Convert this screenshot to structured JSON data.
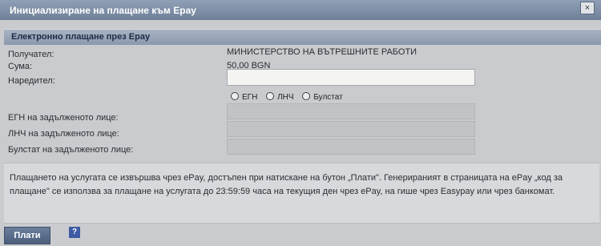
{
  "window": {
    "title": "Инициализиране на плащане към Epay",
    "close_glyph": "×"
  },
  "section": {
    "title": "Електронно плащане през Epay"
  },
  "form": {
    "recipient_label": "Получател:",
    "recipient_value": "МИНИСТЕРСТВО НА ВЪТРЕШНИТЕ РАБОТИ",
    "amount_label": "Сума:",
    "amount_value": "50,00  BGN",
    "payer_label": "Наредител:",
    "payer_value": "",
    "id_type_options": [
      "ЕГН",
      "ЛНЧ",
      "Булстат"
    ],
    "egn_label": "ЕГН на задълженото лице:",
    "lnch_label": "ЛНЧ на задълженото лице:",
    "bulstat_label": "Булстат на задълженото лице:"
  },
  "info": {
    "text": "Плащането на услугата се извършва чрез ePay, достъпен при натискане на бутон „Плати\". Генерираният в страницата на ePay „код за плащане\" се използва за плащане на услугата до 23:59:59 часа на текущия ден чрез ePay, на гише чрез Easypay или чрез банкомат."
  },
  "actions": {
    "pay_label": "Плати",
    "help_label": "?"
  }
}
